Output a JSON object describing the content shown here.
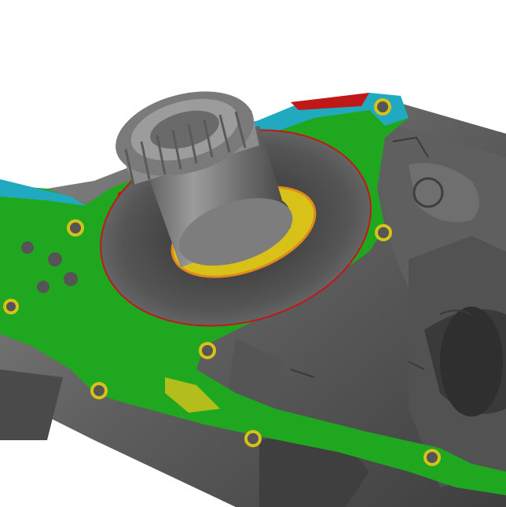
{
  "viewport": {
    "background": "#ffffff"
  },
  "scan": {
    "colors": {
      "metal_dark": "#4a4a4a",
      "metal_mid": "#6e6e6e",
      "metal_light": "#9a9a9a",
      "deviation_green": "#1fa81f",
      "deviation_yellow": "#d8c21a",
      "deviation_cyan": "#21a9c0",
      "deviation_red": "#c01818",
      "deviation_orange": "#e08a1a"
    }
  }
}
